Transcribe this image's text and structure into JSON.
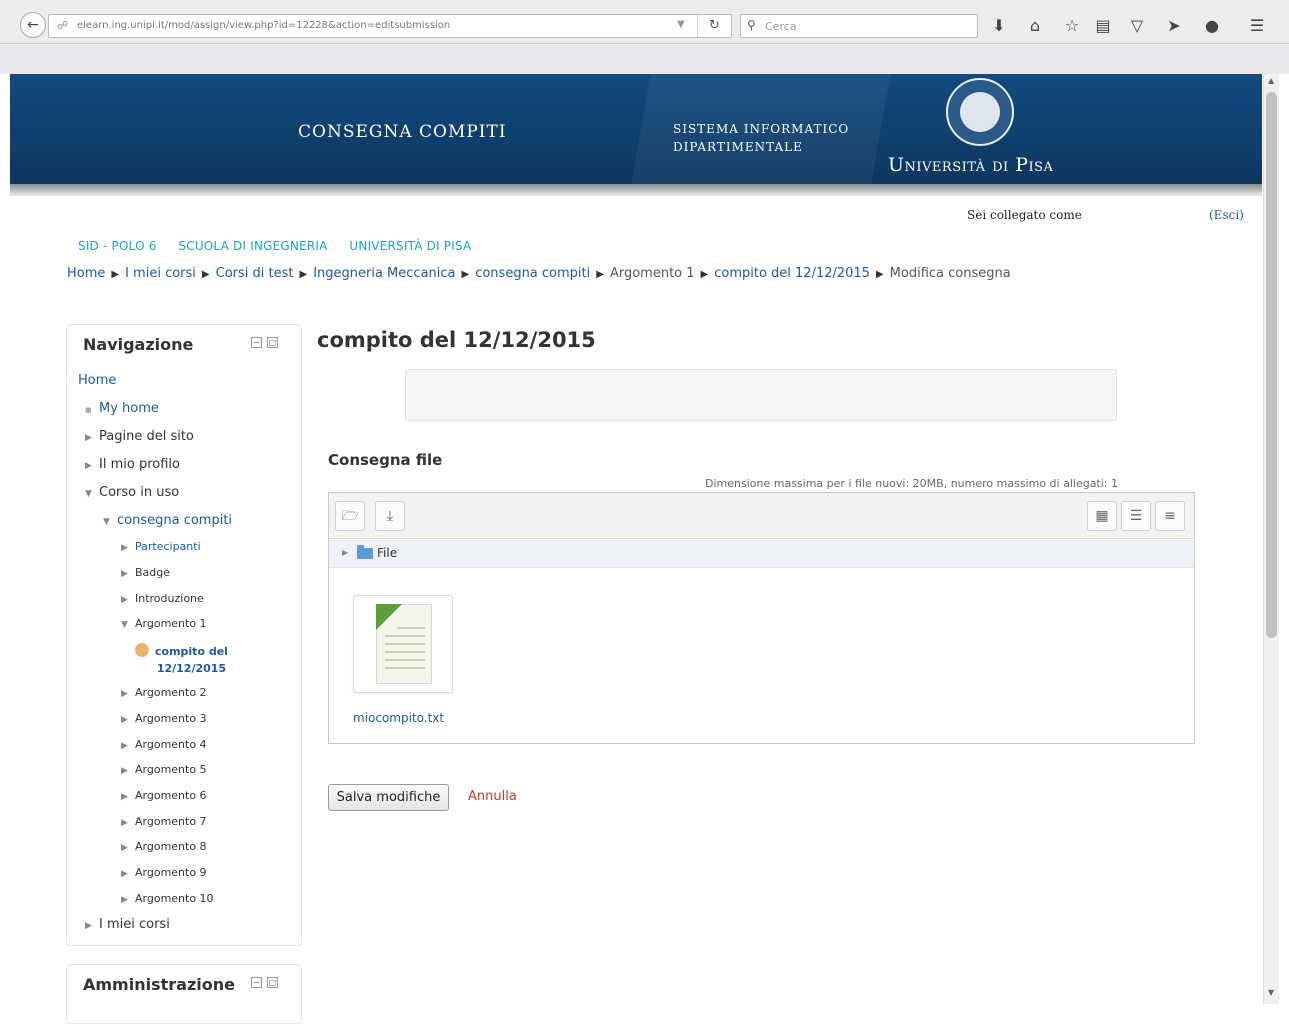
{
  "browser": {
    "url": "elearn.ing.unipi.it/mod/assign/view.php?id=12228&action=editsubmission",
    "search_placeholder": "Cerca"
  },
  "banner": {
    "title": "CONSEGNA COMPITI",
    "subtitle_line1": "SISTEMA INFORMATICO",
    "subtitle_line2": "DIPARTIMENTALE",
    "university": "Università di Pisa",
    "background_color": "#0e3d6e"
  },
  "user": {
    "logged_in_text": "Sei collegato come",
    "logout_label": "(Esci)"
  },
  "top_links": [
    "SID - POLO 6",
    "SCUOLA DI INGEGNERIA",
    "UNIVERSITÀ DI PISA"
  ],
  "breadcrumb": {
    "items": [
      "Home",
      "I miei corsi",
      "Corsi di test",
      "Ingegneria Meccanica",
      "consegna compiti",
      "Argomento 1",
      "compito del 12/12/2015"
    ],
    "current": "Modifica consegna"
  },
  "navigation": {
    "title": "Navigazione",
    "home": "Home",
    "my_home": "My home",
    "site_pages": "Pagine del sito",
    "my_profile": "Il mio profilo",
    "current_course": "Corso in uso",
    "course": "consegna compiti",
    "participants": "Partecipanti",
    "badge": "Badge",
    "introduction": "Introduzione",
    "topics": [
      "Argomento 1",
      "Argomento 2",
      "Argomento 3",
      "Argomento 4",
      "Argomento 5",
      "Argomento 6",
      "Argomento 7",
      "Argomento 8",
      "Argomento 9",
      "Argomento 10"
    ],
    "assignment_line1": "compito del",
    "assignment_line2": "12/12/2015",
    "my_courses": "I miei corsi"
  },
  "administration": {
    "title": "Amministrazione"
  },
  "main": {
    "title": "compito del 12/12/2015",
    "section_label": "Consegna file",
    "max_size_text": "Dimensione massima per i file nuovi: 20MB, numero massimo di allegati: 1",
    "folder_label": "File",
    "file_name": "miocompito.txt",
    "save_label": "Salva modifiche",
    "cancel_label": "Annulla"
  },
  "colors": {
    "link": "#1a5aa5",
    "top_link": "#1aa4c4",
    "cancel": "#c0392b"
  }
}
